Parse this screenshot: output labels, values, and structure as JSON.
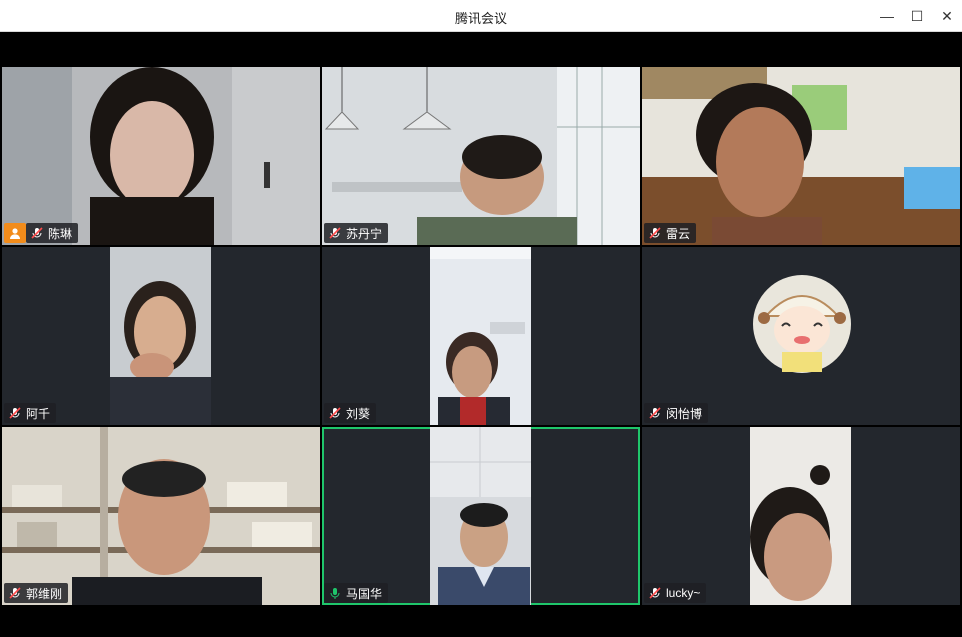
{
  "window": {
    "title": "腾讯会议",
    "controls": {
      "minimize": "—",
      "maximize": "☐",
      "close": "✕"
    }
  },
  "colors": {
    "active_speaker_border": "#1fc66b",
    "host_badge": "#f28c1b",
    "tile_bg": "#23272d"
  },
  "participants": [
    {
      "name": "陈琳",
      "mic": "muted",
      "host": true
    },
    {
      "name": "苏丹宁",
      "mic": "muted",
      "host": false
    },
    {
      "name": "雷云",
      "mic": "muted",
      "host": false
    },
    {
      "name": "阿千",
      "mic": "muted",
      "host": false
    },
    {
      "name": "刘葵",
      "mic": "muted",
      "host": false
    },
    {
      "name": "闵怡博",
      "mic": "muted",
      "host": false,
      "avatar": "cartoon-avatar"
    },
    {
      "name": "郭维刚",
      "mic": "muted",
      "host": false
    },
    {
      "name": "马国华",
      "mic": "speaking",
      "host": false,
      "active": true
    },
    {
      "name": "lucky~",
      "mic": "muted",
      "host": false
    }
  ]
}
